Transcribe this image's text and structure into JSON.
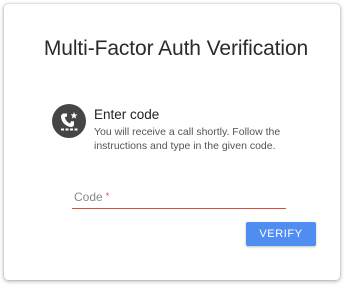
{
  "title": "Multi-Factor Auth Verification",
  "method": {
    "icon": "phone-call-icon",
    "title": "Enter code",
    "description": "You will receive a call shortly. Follow the instructions and type in the given code."
  },
  "code_field": {
    "label": "Code",
    "required_mark": "*",
    "value": ""
  },
  "verify_button": {
    "label": "VERIFY"
  },
  "colors": {
    "accent": "#4f8ef0",
    "error_underline": "#e04a3f",
    "icon": "#444444"
  }
}
